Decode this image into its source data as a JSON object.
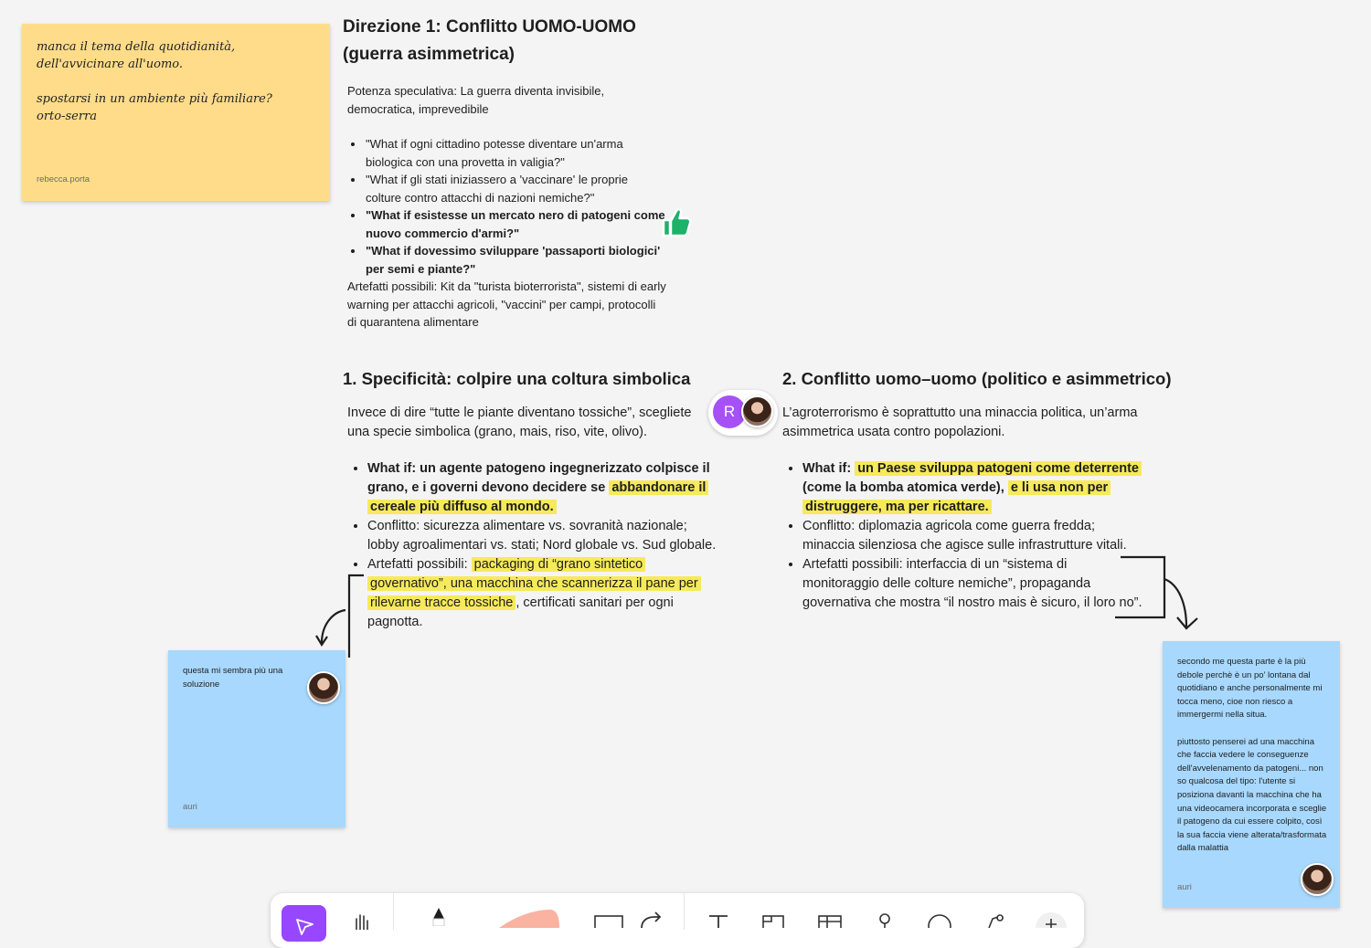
{
  "sticky_rebecca": {
    "text": "manca il tema della quotidianità,\ndell'avvicinare all'uomo.\n\nspostarsi in un ambiente più familiare?\norto-serra",
    "author": "rebecca.porta"
  },
  "direction": {
    "title_line1": "Direzione 1: Conflitto UOMO-UOMO",
    "title_line2": "(guerra asimmetrica)",
    "potenza": "Potenza speculativa: La guerra diventa invisibile, democratica, imprevedibile",
    "bullets": [
      "\"What if ogni cittadino potesse diventare un'arma biologica con una provetta in valigia?\"",
      "\"What if gli stati iniziassero a 'vaccinare' le proprie colture contro attacchi di nazioni nemiche?\"",
      "\"What if esistesse un mercato nero di patogeni come nuovo commercio d'armi?\"",
      "\"What if dovessimo sviluppare 'passaporti biologici' per semi e piante?\""
    ],
    "artefatti": "Artefatti possibili: Kit da \"turista bioterrorista\", sistemi di early warning per attacchi agricoli, \"vaccini\" per campi, protocolli di quarantena alimentare"
  },
  "section1": {
    "title": "1. Specificità: colpire una coltura simbolica",
    "intro": "Invece di dire “tutte le piante diventano tossiche”, scegliete una specie simbolica (grano, mais, riso, vite, olivo).",
    "b1_prefix": "What if: un agente patogeno ingegnerizzato colpisce il grano, e i governi devono decidere se ",
    "b1_highlight": "abbandonare il cereale più diffuso al mondo.",
    "b2": "Conflitto: sicurezza alimentare vs. sovranità nazionale; lobby agroalimentari vs. stati; Nord globale vs. Sud globale.",
    "b3_prefix": "Artefatti possibili: ",
    "b3_highlight": "packaging di “grano sintetico governativo”, una macchina che scannerizza il pane per rilevarne tracce tossiche",
    "b3_suffix": ", certificati sanitari per ogni pagnotta."
  },
  "section2": {
    "title": "2. Conflitto uomo–uomo (politico e asimmetrico)",
    "intro": "L’agroterrorismo è soprattutto una minaccia politica, un’arma asimmetrica usata contro popolazioni.",
    "b1_prefix": "What if: ",
    "b1_hl1": "un Paese sviluppa patogeni come deterrente",
    "b1_mid": " (come la bomba atomica verde), ",
    "b1_hl2": "e li usa non per distruggere, ma per ricattare.",
    "b2": "Conflitto: diplomazia agricola come guerra fredda; minaccia silenziosa che agisce sulle infrastrutture vitali.",
    "b3": "Artefatti possibili: interfaccia di un “sistema di monitoraggio delle colture nemiche”, propaganda governativa che mostra “il nostro mais è sicuro, il loro no”."
  },
  "presence": {
    "initial": "R",
    "color": "#a651f5"
  },
  "sticky_auri_left": {
    "text": "questa mi sembra più una soluzione",
    "author": "auri"
  },
  "sticky_auri_right": {
    "text": "secondo me questa parte è la più debole perchè è un po' lontana dal quotidiano e anche personalmente mi tocca meno, cioe non riesco a immergermi nella situa.\n\npiuttosto penserei ad una macchina che faccia vedere le conseguenze dell'avvelenamento da patogeni... non so qualcosa del tipo: l'utente si posiziona davanti la macchina che ha una videocamera incorporata e sceglie il patogeno da cui essere colpito, così la sua faccia viene alterata/trasformata dalla malattia",
    "author": "auri"
  },
  "colors": {
    "highlight": "#f6ea5a",
    "sticky_yellow": "#ffdc8a",
    "sticky_blue": "#a8d8fd",
    "accent": "#a651f5",
    "thumb_green": "#1db169"
  },
  "toolbar": {
    "tools": [
      "move-tool",
      "hand-tool",
      "marker-tool",
      "highlighter-tool",
      "shape-tool",
      "connector-tool",
      "text-tool",
      "section-tool",
      "table-tool",
      "stamp-tool",
      "sticker-tool",
      "widgets-tool",
      "more-tool"
    ]
  }
}
